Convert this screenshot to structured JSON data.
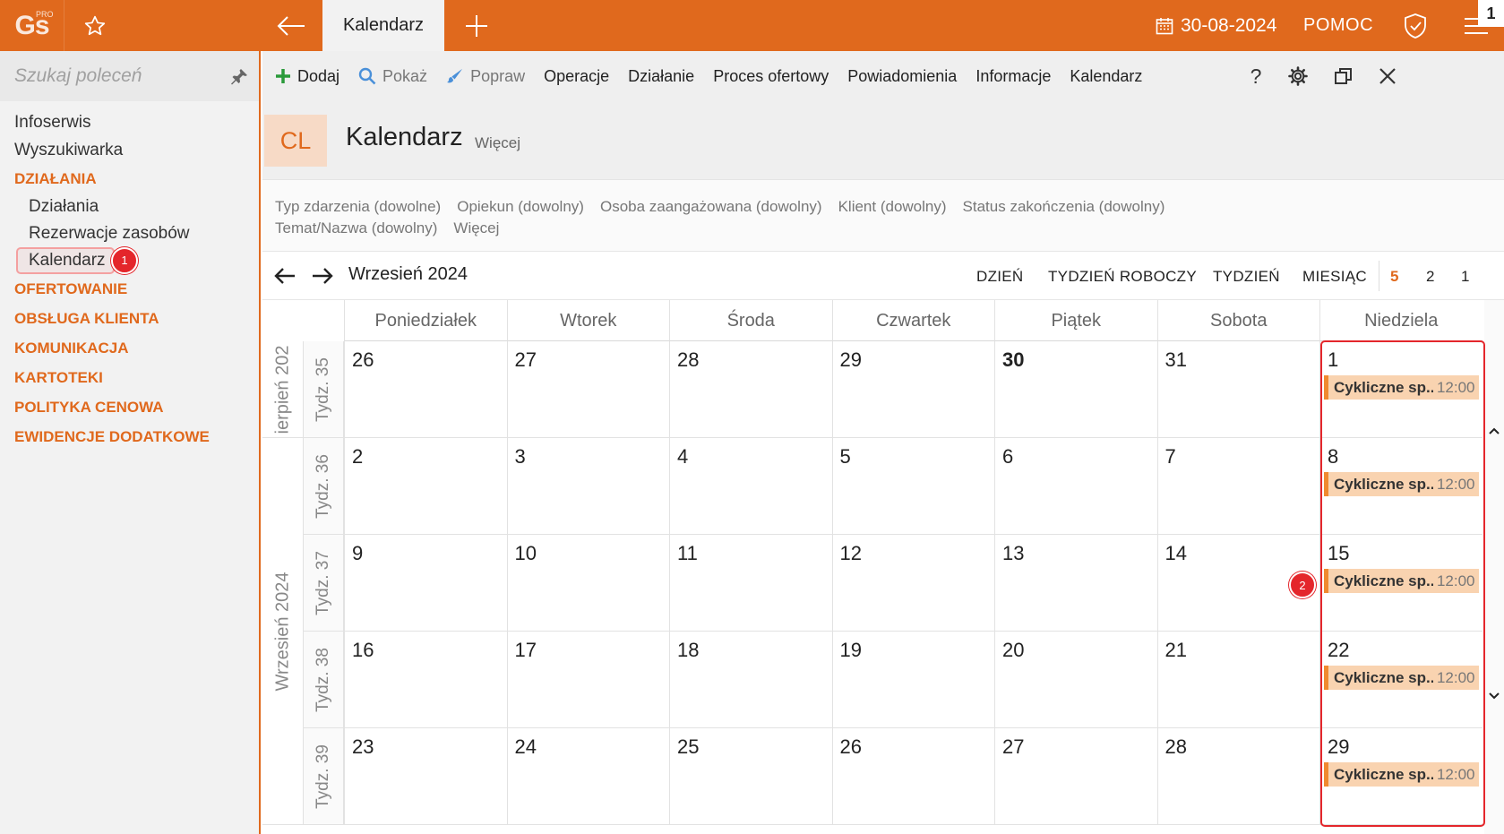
{
  "app": {
    "logo_text": "Gs",
    "logo_badge": "PRO",
    "active_tab": "Kalendarz",
    "date": "30-08-2024",
    "help": "POMOC",
    "notification_count": "1"
  },
  "sidebar": {
    "search_placeholder": "Szukaj poleceń",
    "items": [
      {
        "label": "Infoserwis",
        "kind": "item"
      },
      {
        "label": "Wyszukiwarka",
        "kind": "item"
      },
      {
        "label": "DZIAŁANIA",
        "kind": "section"
      },
      {
        "label": "Działania",
        "kind": "sub"
      },
      {
        "label": "Rezerwacje zasobów",
        "kind": "sub"
      },
      {
        "label": "Kalendarz",
        "kind": "sub-active"
      },
      {
        "label": "OFERTOWANIE",
        "kind": "section"
      },
      {
        "label": "OBSŁUGA KLIENTA",
        "kind": "section"
      },
      {
        "label": "KOMUNIKACJA",
        "kind": "section"
      },
      {
        "label": "KARTOTEKI",
        "kind": "section"
      },
      {
        "label": "POLITYKA CENOWA",
        "kind": "section"
      },
      {
        "label": "EWIDENCJE DODATKOWE",
        "kind": "section"
      }
    ],
    "badge": "1"
  },
  "toolbar": {
    "add": "Dodaj",
    "show": "Pokaż",
    "edit": "Popraw",
    "operations": "Operacje",
    "action": "Działanie",
    "offer_process": "Proces ofertowy",
    "notifications": "Powiadomienia",
    "information": "Informacje",
    "calendar": "Kalendarz",
    "help_icon": "?"
  },
  "header": {
    "code": "CL",
    "title": "Kalendarz",
    "more": "Więcej"
  },
  "filters": {
    "row1": [
      "Typ zdarzenia (dowolne)",
      "Opiekun (dowolny)",
      "Osoba zaangażowana (dowolny)",
      "Klient (dowolny)",
      "Status zakończenia (dowolny)"
    ],
    "row2": [
      "Temat/Nazwa (dowolny)",
      "Więcej"
    ]
  },
  "calendar": {
    "month": "Wrzesień 2024",
    "views": [
      "DZIEŃ",
      "TYDZIEŃ ROBOCZY",
      "TYDZIEŃ",
      "MIESIĄC"
    ],
    "counts": [
      "5",
      "2",
      "1"
    ],
    "days": [
      "Poniedziałek",
      "Wtorek",
      "Środa",
      "Czwartek",
      "Piątek",
      "Sobota",
      "Niedziela"
    ],
    "month_labels": [
      "ierpień 202",
      "Wrzesień 2024"
    ],
    "weeks": [
      {
        "label": "Tydz. 35",
        "dates": [
          "26",
          "27",
          "28",
          "29",
          "30",
          "31",
          "1"
        ]
      },
      {
        "label": "Tydz. 36",
        "dates": [
          "2",
          "3",
          "4",
          "5",
          "6",
          "7",
          "8"
        ]
      },
      {
        "label": "Tydz. 37",
        "dates": [
          "9",
          "10",
          "11",
          "12",
          "13",
          "14",
          "15"
        ]
      },
      {
        "label": "Tydz. 38",
        "dates": [
          "16",
          "17",
          "18",
          "19",
          "20",
          "21",
          "22"
        ]
      },
      {
        "label": "Tydz. 39",
        "dates": [
          "23",
          "24",
          "25",
          "26",
          "27",
          "28",
          "29"
        ]
      }
    ],
    "today": "30",
    "event": {
      "title": "Cykliczne sp...",
      "time": "12:00"
    },
    "badge": "2"
  },
  "colors": {
    "accent": "#e0691d",
    "event_bg": "#f9d3b0",
    "event_border": "#f08a30",
    "highlight": "#e4262b"
  }
}
